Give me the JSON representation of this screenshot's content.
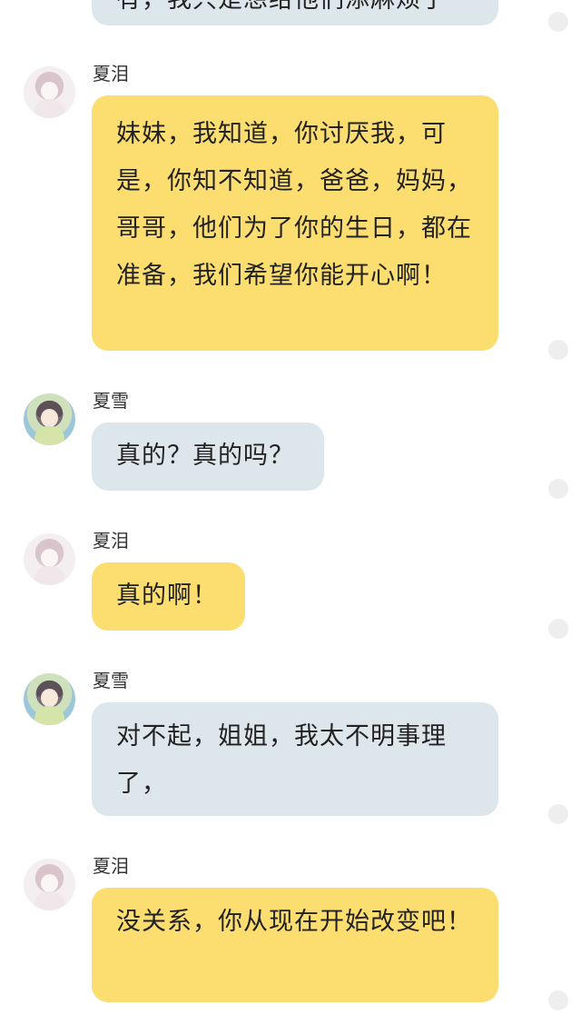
{
  "messages": [
    {
      "sender": "",
      "text": "有，我只是想给他们添麻烦了",
      "style": "gray"
    },
    {
      "sender": "夏泪",
      "text": "妹妹，我知道，你讨厌我，可是，你知不知道，爸爸，妈妈，哥哥，他们为了你的生日，都在准备，我们希望你能开心啊！",
      "style": "yellow"
    },
    {
      "sender": "夏雪",
      "text": "真的？真的吗？",
      "style": "gray"
    },
    {
      "sender": "夏泪",
      "text": "真的啊！",
      "style": "yellow"
    },
    {
      "sender": "夏雪",
      "text": "对不起，姐姐，我太不明事理了，",
      "style": "gray"
    },
    {
      "sender": "夏泪",
      "text": "没关系，你从现在开始改变吧！",
      "style": "yellow"
    }
  ],
  "colors": {
    "yellow_bubble": "#fcdd70",
    "gray_bubble": "#dde6ea"
  }
}
